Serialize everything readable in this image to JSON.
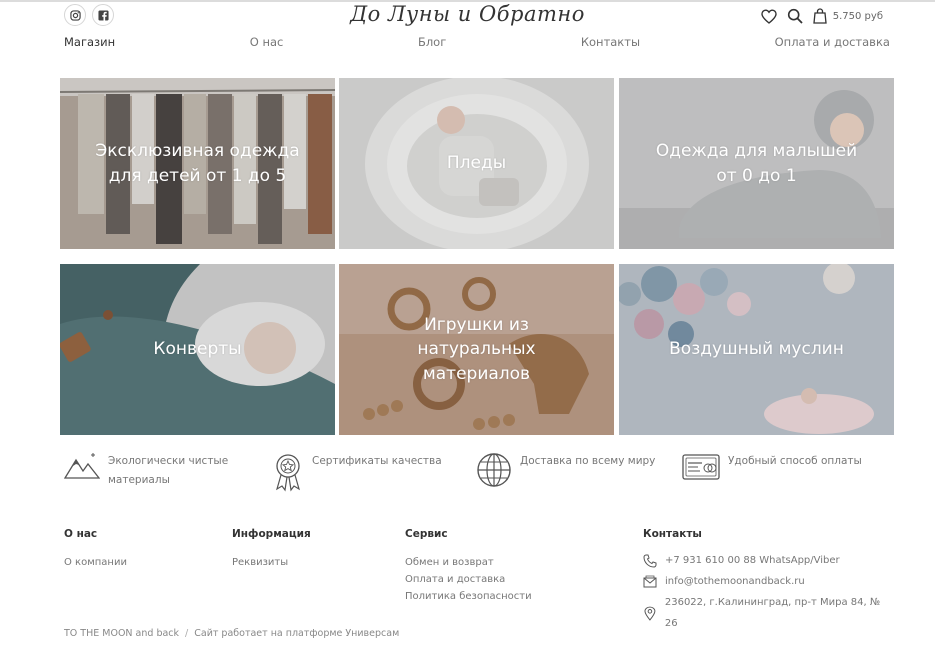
{
  "header": {
    "logo": "До Луны и Обратно",
    "cart_price": "5.750 руб",
    "social": [
      {
        "icon": "instagram-icon"
      },
      {
        "icon": "facebook-icon"
      }
    ]
  },
  "nav": {
    "items": [
      {
        "label": "Магазин"
      },
      {
        "label": "О нас"
      },
      {
        "label": "Блог"
      },
      {
        "label": "Контакты"
      },
      {
        "label": "Оплата и доставка"
      }
    ]
  },
  "categories": [
    {
      "label": "Эксклюзивная одежда для детей от 1 до 5",
      "color": "#b9aca1"
    },
    {
      "label": "Пледы",
      "color": "#d7d7d6"
    },
    {
      "label": "Одежда для малышей от 0 до 1",
      "color": "#c8c8c9"
    },
    {
      "label": "Конверты",
      "color": "#5e7e80"
    },
    {
      "label": "Игрушки из натуральных материалов",
      "color": "#c4a58f"
    },
    {
      "label": "Воздушный муслин",
      "color": "#b9c3cd"
    }
  ],
  "features": [
    {
      "icon": "mountains-icon",
      "text": "Экологически чистые материалы"
    },
    {
      "icon": "award-icon",
      "text": "Сертификаты качества"
    },
    {
      "icon": "globe-icon",
      "text": "Доставка по всему миру"
    },
    {
      "icon": "credit-card-icon",
      "text": "Удобный способ оплаты"
    }
  ],
  "footer": {
    "about": {
      "title": "О нас",
      "links": [
        "О компании"
      ]
    },
    "info": {
      "title": "Информация",
      "links": [
        "Реквизиты"
      ]
    },
    "service": {
      "title": "Сервис",
      "links": [
        "Обмен и возврат",
        "Оплата и доставка",
        "Политика безопасности"
      ]
    },
    "contacts": {
      "title": "Контакты",
      "phone": "+7 931 610 00 88 WhatsApp/Viber",
      "email": "info@tothemoonandback.ru",
      "address": "236022, г.Калининград, пр-т Мира 84, № 26"
    },
    "copyright_brand": "TO THE MOON and back",
    "copyright_note": "Сайт работает на платформе Универсам"
  }
}
